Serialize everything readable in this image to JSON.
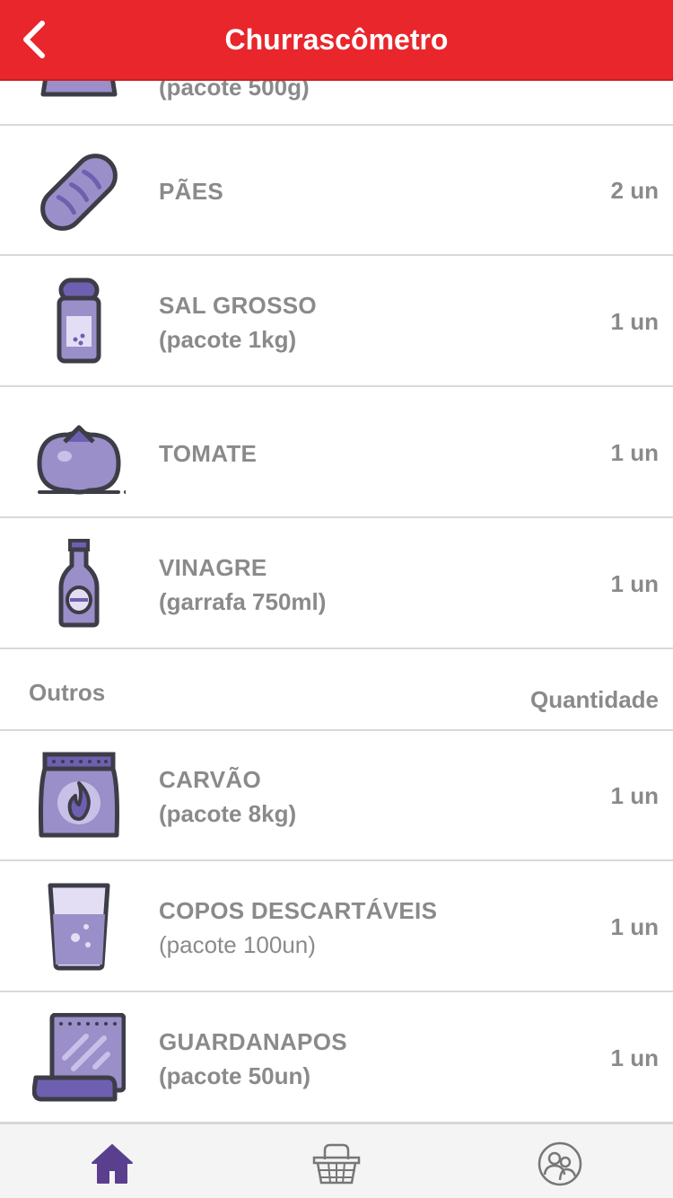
{
  "header": {
    "title": "Churrascômetro",
    "back_icon": "chevron-left-icon"
  },
  "colors": {
    "header_bg": "#e8262b",
    "text_gray": "#8a8a8a",
    "icon_fill": "#9b8fc9",
    "icon_stroke": "#3d3d47",
    "tab_active": "#5b3f8f"
  },
  "partial_row": {
    "sub": "(pacote 500g)"
  },
  "items": [
    {
      "name": "PÃES",
      "sub": "",
      "qty": "2 un",
      "icon": "bread-icon"
    },
    {
      "name": "SAL GROSSO",
      "sub": "(pacote 1kg)",
      "qty": "1 un",
      "icon": "salt-shaker-icon"
    },
    {
      "name": "TOMATE",
      "sub": "",
      "qty": "1 un",
      "icon": "tomato-icon"
    },
    {
      "name": "VINAGRE",
      "sub": "(garrafa 750ml)",
      "qty": "1 un",
      "icon": "bottle-icon"
    }
  ],
  "section": {
    "title": "Outros",
    "qty_header": "Quantidade"
  },
  "outros": [
    {
      "name": "CARVÃO",
      "sub": "(pacote 8kg)",
      "qty": "1 un",
      "icon": "charcoal-bag-icon"
    },
    {
      "name": "COPOS DESCARTÁVEIS",
      "sub": "(pacote 100un)",
      "qty": "1 un",
      "icon": "cup-icon"
    },
    {
      "name": "GUARDANAPOS",
      "sub": "(pacote 50un)",
      "qty": "1 un",
      "icon": "napkin-icon"
    }
  ],
  "tabs": [
    {
      "name": "home",
      "icon": "home-icon",
      "active": true
    },
    {
      "name": "basket",
      "icon": "basket-icon",
      "active": false
    },
    {
      "name": "people",
      "icon": "people-icon",
      "active": false
    }
  ]
}
